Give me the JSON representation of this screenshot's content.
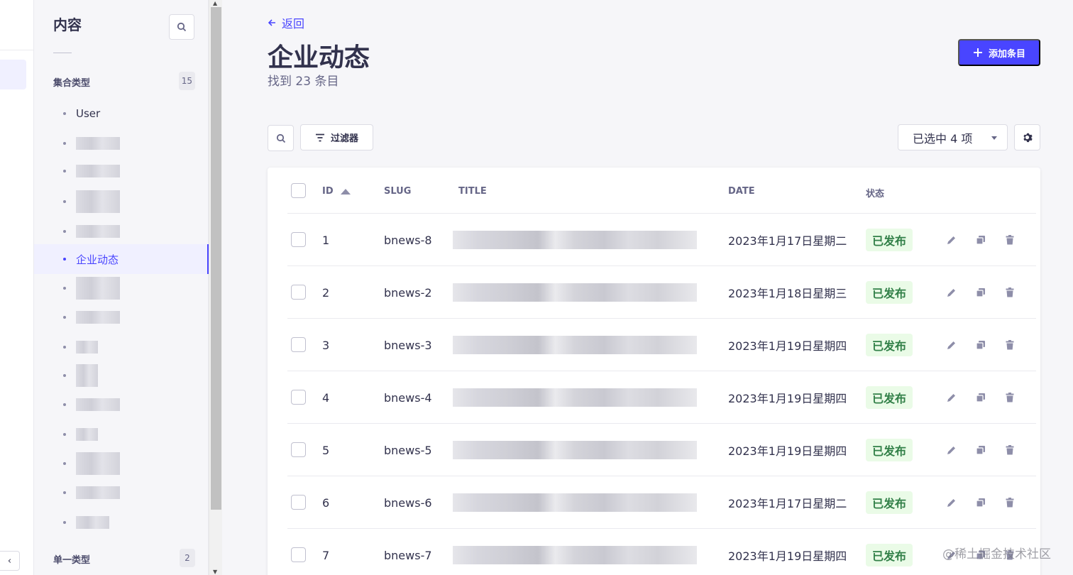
{
  "sidebar": {
    "title": "内容",
    "collection_header": "集合类型",
    "collection_count": "15",
    "single_header": "单一类型",
    "single_count": "2",
    "items": [
      {
        "label": "User",
        "blurred": false,
        "active": false
      },
      {
        "label": "",
        "blurred": true,
        "active": false
      },
      {
        "label": "",
        "blurred": true,
        "active": false
      },
      {
        "label": "",
        "blurred": true,
        "active": false
      },
      {
        "label": "",
        "blurred": true,
        "active": false
      },
      {
        "label": "企业动态",
        "blurred": false,
        "active": true
      },
      {
        "label": "",
        "blurred": true,
        "active": false
      },
      {
        "label": "",
        "blurred": true,
        "active": false
      },
      {
        "label": "",
        "blurred": true,
        "active": false
      },
      {
        "label": "",
        "blurred": true,
        "active": false
      },
      {
        "label": "",
        "blurred": true,
        "active": false
      },
      {
        "label": "",
        "blurred": true,
        "active": false
      },
      {
        "label": "",
        "blurred": true,
        "active": false
      },
      {
        "label": "",
        "blurred": true,
        "active": false
      },
      {
        "label": "",
        "blurred": true,
        "active": false
      }
    ]
  },
  "header": {
    "back_label": "返回",
    "title": "企业动态",
    "subtitle": "找到 23 条目",
    "add_label": "添加条目"
  },
  "toolbar": {
    "filter_label": "过滤器",
    "columns_select": "已选中 4 项"
  },
  "table": {
    "columns": {
      "id": "ID",
      "slug": "SLUG",
      "title": "TITLE",
      "date": "DATE",
      "status": "状态"
    },
    "rows": [
      {
        "id": "1",
        "slug": "bnews-8",
        "date": "2023年1月17日星期二",
        "status": "已发布"
      },
      {
        "id": "2",
        "slug": "bnews-2",
        "date": "2023年1月18日星期三",
        "status": "已发布"
      },
      {
        "id": "3",
        "slug": "bnews-3",
        "date": "2023年1月19日星期四",
        "status": "已发布"
      },
      {
        "id": "4",
        "slug": "bnews-4",
        "date": "2023年1月19日星期四",
        "status": "已发布"
      },
      {
        "id": "5",
        "slug": "bnews-5",
        "date": "2023年1月19日星期四",
        "status": "已发布"
      },
      {
        "id": "6",
        "slug": "bnews-6",
        "date": "2023年1月17日星期二",
        "status": "已发布"
      },
      {
        "id": "7",
        "slug": "bnews-7",
        "date": "2023年1月19日星期四",
        "status": "已发布"
      }
    ]
  },
  "watermark": "@稀土掘金技术社区",
  "colors": {
    "primary": "#4945ff",
    "success_bg": "#eafbe7",
    "success_text": "#328048",
    "text": "#32324d",
    "muted": "#666687"
  },
  "icons": [
    "search-icon",
    "arrow-left-icon",
    "plus-icon",
    "filter-icon",
    "gear-icon",
    "sort-up-icon",
    "pencil-icon",
    "duplicate-icon",
    "trash-icon",
    "chevron-left-icon",
    "caret-down-icon"
  ]
}
